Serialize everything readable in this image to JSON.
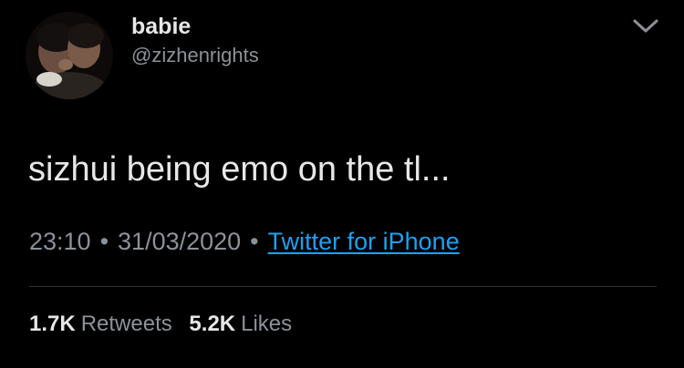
{
  "tweet": {
    "author": {
      "display_name": "babie",
      "handle": "@zizhenrights"
    },
    "text": "sizhui being emo on the tl...",
    "meta": {
      "time": "23:10",
      "separator": "•",
      "date": "31/03/2020",
      "source": "Twitter for iPhone"
    },
    "stats": {
      "retweets_count": "1.7K",
      "retweets_label": "Retweets",
      "likes_count": "5.2K",
      "likes_label": "Likes"
    }
  },
  "icons": {
    "more": "chevron-down-icon",
    "avatar": "avatar"
  },
  "colors": {
    "background": "#000000",
    "primary_text": "#e7e7e7",
    "secondary_text": "#8b9299",
    "link": "#1da1f2",
    "divider": "#2f3336"
  }
}
